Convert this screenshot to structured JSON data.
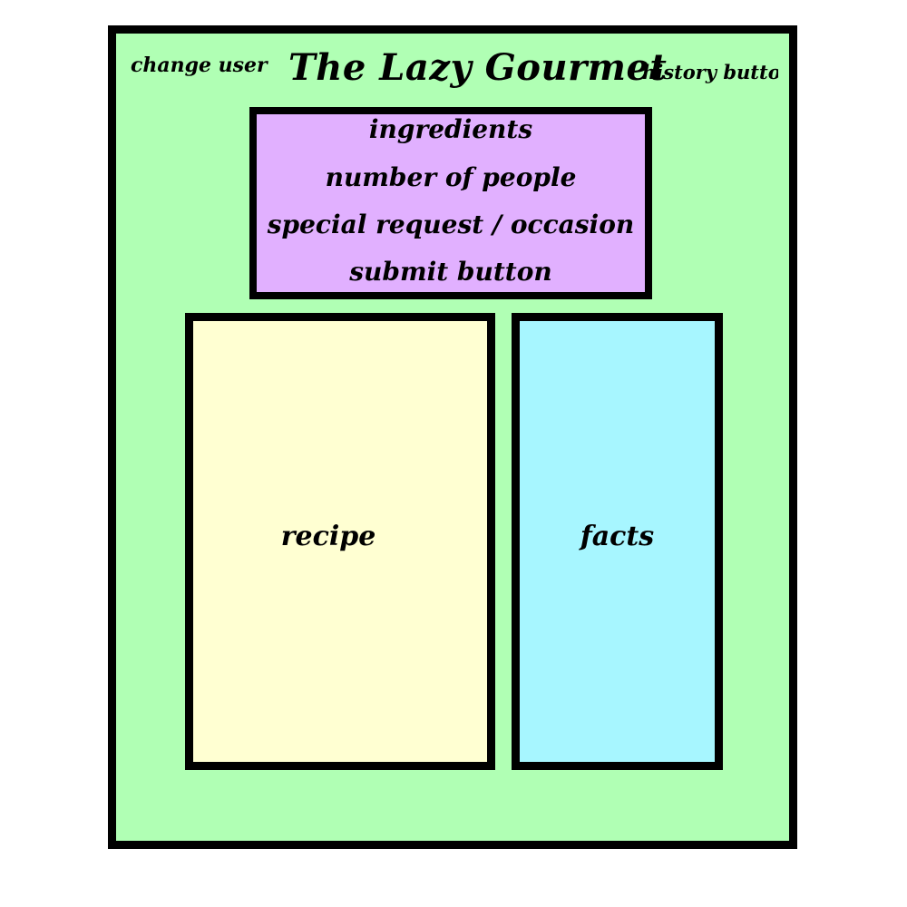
{
  "header": {
    "change_user": "change user",
    "title": "The Lazy Gourmet",
    "history_button": "history buttor"
  },
  "form": {
    "ingredients": "ingredients",
    "number_of_people": "number of people",
    "special_request": "special request / occasion",
    "submit": "submit button"
  },
  "panels": {
    "recipe": "recipe",
    "facts": "facts"
  },
  "colors": {
    "background": "#b0ffb4",
    "form_panel": "#e1b0ff",
    "recipe_panel": "#ffffd2",
    "facts_panel": "#a7f6ff",
    "border": "#000000"
  }
}
